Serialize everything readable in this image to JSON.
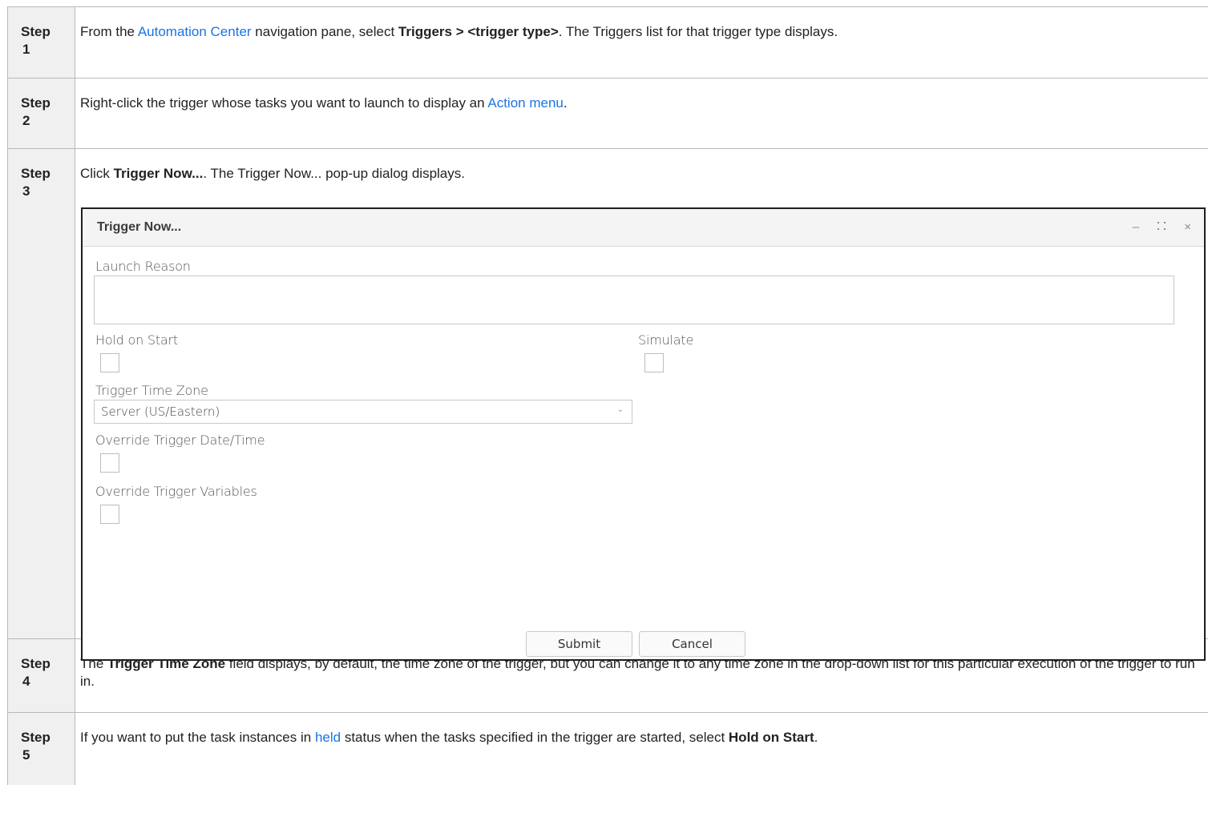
{
  "steps": [
    {
      "step_word": "Step",
      "num": "1",
      "pre": "From the ",
      "link": "Automation Center",
      "mid": " navigation pane, select ",
      "bold": "Triggers > <trigger type>",
      "post": ". The Triggers list for that trigger type displays."
    },
    {
      "step_word": "Step",
      "num": "2",
      "pre": "Right-click the trigger whose tasks you want to launch to display an ",
      "link": "Action menu",
      "post": "."
    },
    {
      "step_word": "Step",
      "num": "3",
      "pre": "Click ",
      "bold": "Trigger Now...",
      "post": ". The Trigger Now... pop-up dialog displays."
    },
    {
      "step_word": "Step",
      "num": "4",
      "pre": "The ",
      "bold": "Trigger Time Zone",
      "post": " field displays, by default, the time zone of the trigger, but you can change it to any time zone in the drop-down list for this particular execution of the trigger to run in."
    },
    {
      "step_word": "Step",
      "num": "5",
      "pre": "If you want to put the task instances in ",
      "link": "held",
      "mid": " status when the tasks specified in the trigger are started, select ",
      "bold": "Hold on Start",
      "post": "."
    }
  ],
  "dialog": {
    "title": "Trigger Now...",
    "ctrl_minimize": "–",
    "ctrl_maximize": "⛶",
    "ctrl_close": "×",
    "launch_reason_label": "Launch Reason",
    "launch_reason_value": "",
    "hold_on_start_label": "Hold on Start",
    "hold_on_start_checked": false,
    "simulate_label": "Simulate",
    "simulate_checked": false,
    "time_zone_label": "Trigger Time Zone",
    "time_zone_value": "Server (US/Eastern)",
    "override_datetime_label": "Override Trigger Date/Time",
    "override_datetime_checked": false,
    "override_vars_label": "Override Trigger Variables",
    "override_vars_checked": false,
    "submit_label": "Submit",
    "cancel_label": "Cancel"
  },
  "colors": {
    "link": "#1a73e8",
    "step_bg": "#f0f0f0",
    "border": "#b9b9b9"
  }
}
